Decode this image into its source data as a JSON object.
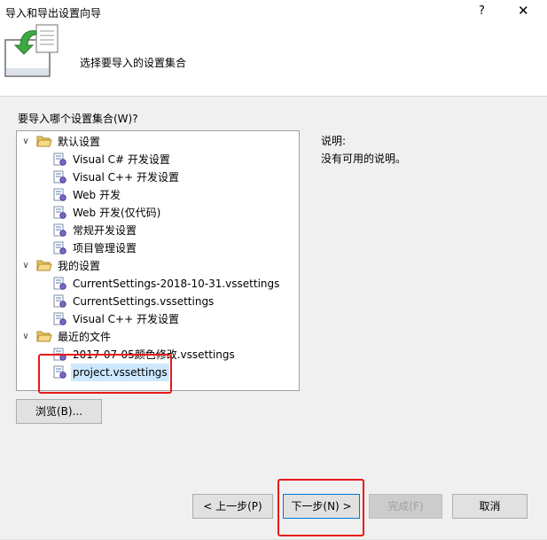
{
  "window": {
    "title": "导入和导出设置向导",
    "help": "?",
    "close": "✕"
  },
  "header": {
    "title": "选择要导入的设置集合"
  },
  "prompt": "要导入哪个设置集合(W)?",
  "tree": {
    "groups": [
      {
        "label": "默认设置",
        "items": [
          "Visual C# 开发设置",
          "Visual C++ 开发设置",
          "Web 开发",
          "Web 开发(仅代码)",
          "常规开发设置",
          "项目管理设置"
        ]
      },
      {
        "label": "我的设置",
        "items": [
          "CurrentSettings-2018-10-31.vssettings",
          "CurrentSettings.vssettings",
          "Visual C++ 开发设置"
        ]
      },
      {
        "label": "最近的文件",
        "items": [
          "2017-07-05颜色修改.vssettings",
          "project.vssettings"
        ]
      }
    ],
    "selected": "project.vssettings",
    "expander": "∨"
  },
  "description": {
    "title": "说明:",
    "text": "没有可用的说明。"
  },
  "buttons": {
    "browse": "浏览(B)...",
    "back": "< 上一步(P)",
    "next": "下一步(N) >",
    "finish": "完成(F)",
    "cancel": "取消"
  },
  "colors": {
    "highlight": "#e8191b",
    "selection": "#cce8ff",
    "focus": "#0078d7"
  },
  "icons": {
    "folder": "folder-open-icon",
    "settings": "settings-file-icon",
    "wizard": "wizard-import-icon"
  }
}
